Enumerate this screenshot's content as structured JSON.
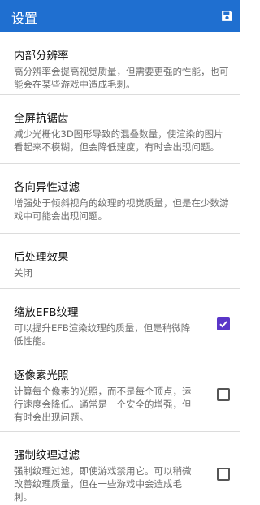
{
  "appbar": {
    "title": "设置",
    "save_icon": "save-icon",
    "color": "#1f6fd0"
  },
  "settings": [
    {
      "title": "内部分辨率",
      "summary": [
        "高分辨率会提高视觉质量，但需要更强的性能，也可",
        "能会在某些游戏中造成毛刺。"
      ]
    },
    {
      "title": "全屏抗锯齿",
      "summary": [
        "减少光栅化3D图形导致的混叠数量，使渲染的图片",
        "看起来不模糊，但会降低速度，有时会出现问题。"
      ]
    },
    {
      "title": "各向异性过滤",
      "summary": [
        "增强处于倾斜视角的纹理的视觉质量，但是在少数游",
        "戏中可能会出现问题。"
      ]
    },
    {
      "title": "后处理效果",
      "summary": [
        "关闭"
      ]
    },
    {
      "title": "缩放EFB纹理",
      "summary": [
        "可以提升EFB渲染纹理的质量，但是稍微降",
        "低性能。"
      ],
      "checked": true
    },
    {
      "title": "逐像素光照",
      "summary": [
        "计算每个像素的光照，而不是每个顶点，运",
        "行速度会降低。通常是一个安全的增强，但",
        "有时会出现问题。"
      ],
      "checked": false
    },
    {
      "title": "强制纹理过滤",
      "summary": [
        "强制纹理过滤，即使游戏禁用它。可以稍微",
        "改善纹理质量，但在一些游戏中会造成毛",
        "刺。"
      ],
      "checked": false
    }
  ],
  "checkbox_color": "#5a36c8"
}
